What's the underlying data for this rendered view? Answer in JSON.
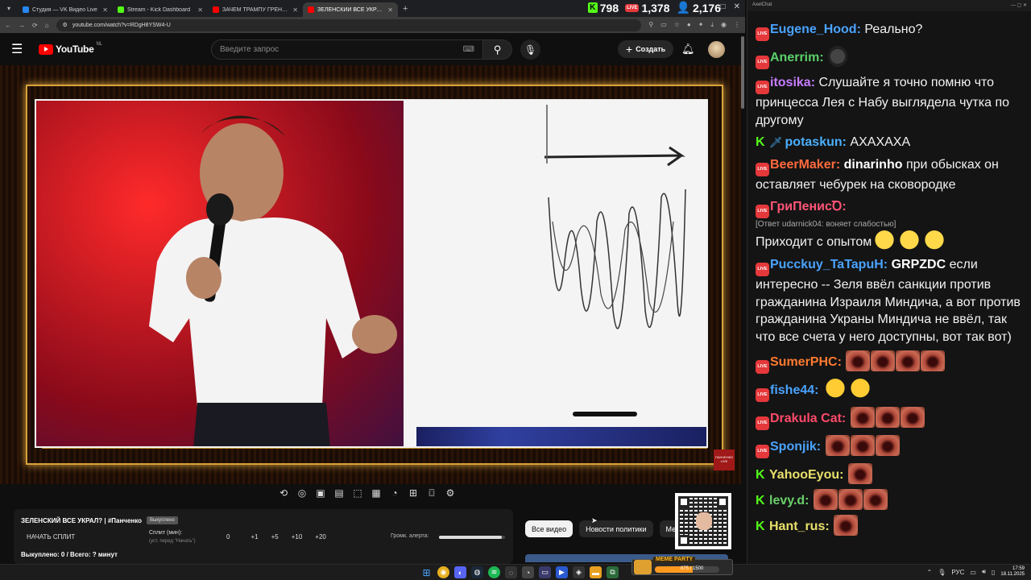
{
  "browser": {
    "tabs": [
      {
        "title": "Студия — VK Видео Live",
        "color": "#2787f5",
        "active": false
      },
      {
        "title": "Stream - Kick Dashboard",
        "color": "#53fc18",
        "active": false
      },
      {
        "title": "ЗАЧЕМ ТРАМПУ ГРЕНЛАНДИ...",
        "color": "#ff0000",
        "active": false
      },
      {
        "title": "ЗЕЛЕНСКИЙ ВСЕ УКРАЛ? | ...",
        "color": "#ff0000",
        "active": true
      }
    ],
    "url": "youtube.com/watch?v=RDgH8YSW4-U",
    "stats": {
      "kick": "798",
      "vk": "1,378",
      "viewers": "2,176"
    }
  },
  "youtube": {
    "logo_text": "YouTube",
    "region": "NL",
    "search_placeholder": "Введите запрос",
    "create_label": "Создать"
  },
  "video": {
    "watermark": "ПАНЧЕНКО LIVE"
  },
  "alert_panel": {
    "title": "ЗЕЛЕНСКИЙ ВСЕ УКРАЛ? | #Панченко",
    "badge": "Выкуплено",
    "split_button": "НАЧАТЬ СПЛИТ",
    "split_label": "Сплит (мин):",
    "split_sub": "(уст. перед \"Начать\")",
    "split_value": "0",
    "increments": [
      "+1",
      "+5",
      "+10",
      "+20"
    ],
    "volume_label": "Громк. алерта:",
    "volume_level": 0.95,
    "bought": "Выкуплено: 0 / Всего: ? минут"
  },
  "chips": [
    "Все видео",
    "Новости политики",
    "Меж"
  ],
  "chat": {
    "title": "AxelChat",
    "messages": [
      {
        "badge": "live",
        "user": "Eugene_Hood",
        "color": "#4aa3ff",
        "text": "Реально?",
        "emotes": []
      },
      {
        "badge": "live",
        "user": "Anerrim",
        "color": "#5ad06a",
        "text": "",
        "emotes": [
          "frog"
        ]
      },
      {
        "badge": "live",
        "user": "itosika",
        "color": "#c77dff",
        "text": "Слушайте я точно помню что принцесса Лея с Набу выглядела чутка по другому",
        "emotes": []
      },
      {
        "badge": "kick",
        "user": "potaskun",
        "color": "#4ab0ff",
        "text": "АХАХАХА",
        "emotes": [],
        "sword": true
      },
      {
        "badge": "live",
        "user": "BeerMaker",
        "color": "#ff6a3d",
        "mention": "dinarinho",
        "text": "при обысках он оставляет чебурек на сковородке",
        "emotes": []
      },
      {
        "badge": "live",
        "user": "ГриПенисꝹ",
        "color": "#ff5577",
        "reply": "[Ответ udarnick04: воняет слабостью]",
        "text": "Приходит с опытом",
        "emotes": [
          "yellow",
          "yellow",
          "yellow"
        ]
      },
      {
        "badge": "live",
        "user": "Pucckuy_TaTapuH",
        "color": "#4aa3ff",
        "mention": "GRPZDC",
        "text": "если интересно -- Зеля ввёл санкции против гражданина Израиля Миндича, а вот против гражданина Украны Миндича не ввёл, так что все счета у него доступны, вот так вот)",
        "emotes": []
      },
      {
        "badge": "live",
        "user": "SumerPHC",
        "color": "#ff7a30",
        "text": "",
        "emotes": [
          "lips",
          "lips",
          "lips",
          "lips"
        ]
      },
      {
        "badge": "live",
        "user": "fishe44",
        "color": "#4aa3ff",
        "text": "",
        "emotes": [
          "laugh",
          "laugh"
        ]
      },
      {
        "badge": "live",
        "user": "Drakula Cat",
        "color": "#ff4a6a",
        "text": "",
        "emotes": [
          "lips",
          "lips",
          "lips"
        ]
      },
      {
        "badge": "live",
        "user": "Sponjik",
        "color": "#4aa3ff",
        "text": "",
        "emotes": [
          "lips",
          "lips",
          "lips"
        ]
      },
      {
        "badge": "kick",
        "user": "YahooEyou",
        "color": "#e8e06a",
        "text": "",
        "emotes": [
          "lips"
        ]
      },
      {
        "badge": "kick",
        "user": "levy.d",
        "color": "#6ad06a",
        "text": "",
        "emotes": [
          "lips",
          "lips",
          "lips"
        ]
      },
      {
        "badge": "kick",
        "user": "Hant_rus",
        "color": "#e8e06a",
        "text": "",
        "emotes": [
          "lips"
        ]
      }
    ]
  },
  "taskbar": {
    "meme_label": "MEME PARTY",
    "meme_count": "875 / 1500",
    "meme_progress": 0.583,
    "lang": "РУС",
    "time": "17:59",
    "date": "18.11.2025"
  }
}
